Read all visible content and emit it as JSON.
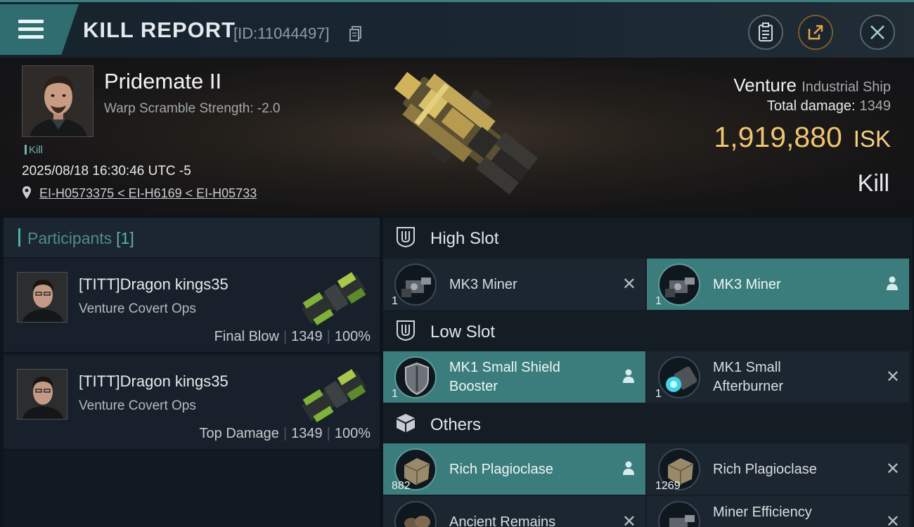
{
  "header": {
    "title": "KILL REPORT",
    "report_id": "[ID:11044497]"
  },
  "victim": {
    "name": "Pridemate II",
    "warp_scramble": "Warp Scramble Strength: -2.0",
    "tag": "Kill",
    "datetime": "2025/08/18 16:30:46 UTC -5",
    "location": "EI-H0573375 < EI-H6169 < EI-H05733"
  },
  "ship": {
    "name": "Venture",
    "class": "Industrial Ship",
    "total_damage_label": "Total damage:",
    "total_damage_value": "1349",
    "isk_value": "1,919,880",
    "isk_unit": "ISK",
    "report_type": "Kill"
  },
  "participants": {
    "label": "Participants",
    "count": "[1]",
    "rows": [
      {
        "name": "[TITT]Dragon kings35",
        "ship": "Venture Covert Ops",
        "role": "Final Blow",
        "damage": "1349",
        "percent": "100%"
      },
      {
        "name": "[TITT]Dragon kings35",
        "ship": "Venture Covert Ops",
        "role": "Top Damage",
        "damage": "1349",
        "percent": "100%"
      }
    ]
  },
  "sections": {
    "high_slot": "High Slot",
    "low_slot": "Low Slot",
    "others": "Others"
  },
  "items": {
    "high1": {
      "name": "MK3 Miner",
      "qty": "1"
    },
    "high2": {
      "name": "MK3 Miner",
      "qty": "1"
    },
    "low1_line1": "MK1 Small Shield",
    "low1_line2": "Booster",
    "low1_qty": "1",
    "low2_line1": "MK1 Small",
    "low2_line2": "Afterburner",
    "low2_qty": "1",
    "other1": {
      "name": "Rich Plagioclase",
      "qty": "882"
    },
    "other2": {
      "name": "Rich Plagioclase",
      "qty": "1269"
    },
    "other3": {
      "name": "Ancient Remains"
    },
    "other4": {
      "name": "Miner Efficiency"
    }
  },
  "colors": {
    "accent_teal": "#3a7d7c",
    "isk_gold": "#f0c46e",
    "background": "#0d141b"
  }
}
